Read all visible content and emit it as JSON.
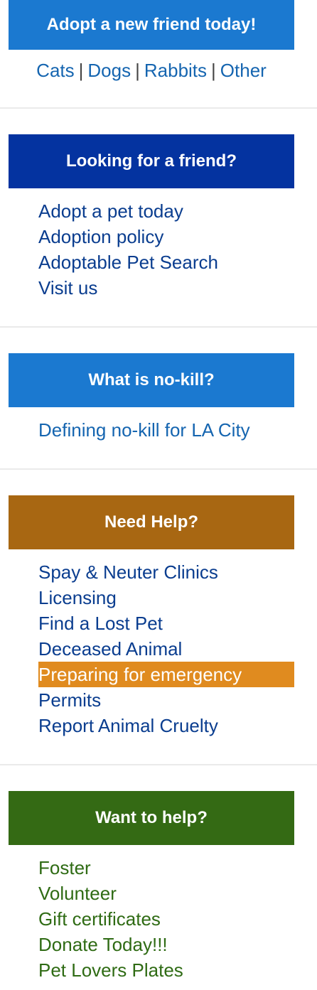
{
  "colors": {
    "header_adopt": "#1b79d0",
    "header_friend": "#0433a0",
    "header_nokill": "#1b79d0",
    "header_help": "#a86712",
    "header_want": "#346a14",
    "highlight": "#e08b1f"
  },
  "adopt": {
    "title": "Adopt a new friend today!",
    "links": [
      "Cats",
      "Dogs",
      "Rabbits",
      "Other"
    ],
    "separator": "|"
  },
  "friend": {
    "title": "Looking for a friend?",
    "links": [
      "Adopt a pet today",
      "Adoption policy",
      "Adoptable Pet Search",
      "Visit us"
    ]
  },
  "nokill": {
    "title": "What is no-kill?",
    "links": [
      "Defining no-kill for LA City"
    ]
  },
  "help": {
    "title": "Need Help?",
    "links": [
      "Spay & Neuter Clinics",
      "Licensing",
      "Find a Lost Pet",
      "Deceased Animal",
      "Preparing for emergency",
      "Permits",
      "Report Animal Cruelty"
    ]
  },
  "want": {
    "title": "Want to help?",
    "links": [
      "Foster",
      "Volunteer",
      "Gift certificates",
      "Donate Today!!!",
      "Pet Lovers Plates"
    ]
  }
}
